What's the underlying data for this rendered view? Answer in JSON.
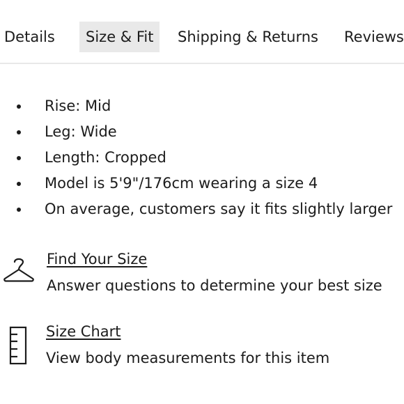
{
  "tabs": [
    {
      "label": "Details",
      "active": false
    },
    {
      "label": "Size & Fit",
      "active": true
    },
    {
      "label": "Shipping & Returns",
      "active": false
    },
    {
      "label": "Reviews",
      "active": false
    }
  ],
  "fit_details": [
    "Rise: Mid",
    "Leg: Wide",
    "Length: Cropped",
    "Model is 5'9\"/176cm wearing a size 4",
    "On average, customers say it fits slightly larger"
  ],
  "find_your_size": {
    "icon": "hanger-icon",
    "title": "Find Your Size",
    "description": "Answer questions to determine your best size"
  },
  "size_chart": {
    "icon": "ruler-icon",
    "title": "Size Chart",
    "description": "View body measurements for this item"
  },
  "colors": {
    "text": "#1c1c1c",
    "active_tab_bg": "#e9e9e9",
    "divider": "#e8e8e8"
  }
}
